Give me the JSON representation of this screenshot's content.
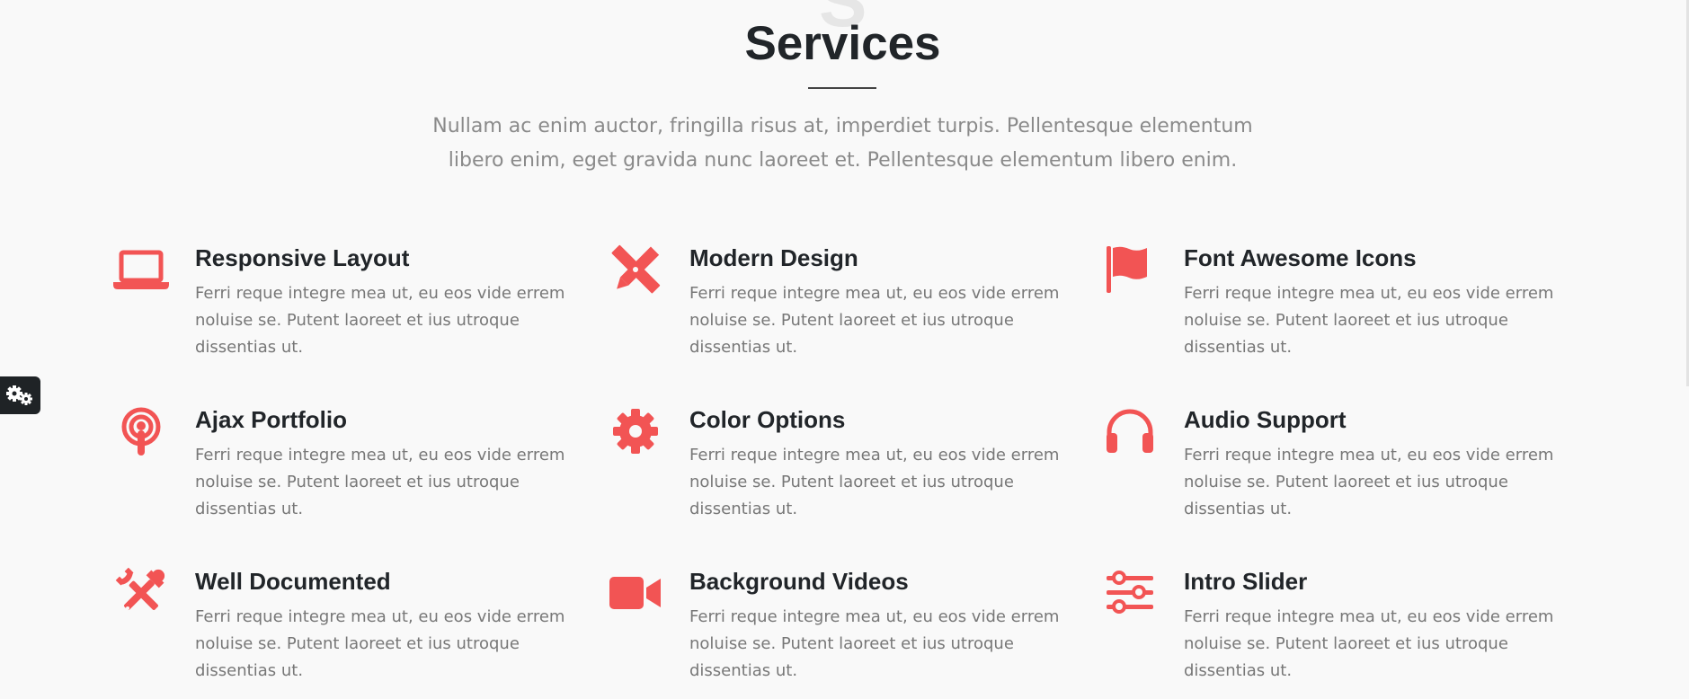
{
  "section": {
    "watermark": "S",
    "title": "Services",
    "lead": "Nullam ac enim auctor, fringilla risus at, imperdiet turpis. Pellentesque elementum libero enim, eget gravida nunc laoreet et. Pellentesque elementum libero enim."
  },
  "colors": {
    "accent": "#f25454",
    "heading": "#212529",
    "body_text": "#777777",
    "background": "#f9f9f9"
  },
  "features": [
    {
      "icon": "laptop-icon",
      "title": "Responsive Layout",
      "text": "Ferri reque integre mea ut, eu eos vide errem noluise se. Putent laoreet et ius utroque dissentias ut."
    },
    {
      "icon": "pencil-ruler-icon",
      "title": "Modern Design",
      "text": "Ferri reque integre mea ut, eu eos vide errem noluise se. Putent laoreet et ius utroque dissentias ut."
    },
    {
      "icon": "flag-icon",
      "title": "Font Awesome Icons",
      "text": "Ferri reque integre mea ut, eu eos vide errem noluise se. Putent laoreet et ius utroque dissentias ut."
    },
    {
      "icon": "podcast-icon",
      "title": "Ajax Portfolio",
      "text": "Ferri reque integre mea ut, eu eos vide errem noluise se. Putent laoreet et ius utroque dissentias ut."
    },
    {
      "icon": "gear-icon",
      "title": "Color Options",
      "text": "Ferri reque integre mea ut, eu eos vide errem noluise se. Putent laoreet et ius utroque dissentias ut."
    },
    {
      "icon": "headphones-icon",
      "title": "Audio Support",
      "text": "Ferri reque integre mea ut, eu eos vide errem noluise se. Putent laoreet et ius utroque dissentias ut."
    },
    {
      "icon": "tools-icon",
      "title": "Well Documented",
      "text": "Ferri reque integre mea ut, eu eos vide errem noluise se. Putent laoreet et ius utroque dissentias ut."
    },
    {
      "icon": "video-camera-icon",
      "title": "Background Videos",
      "text": "Ferri reque integre mea ut, eu eos vide errem noluise se. Putent laoreet et ius utroque dissentias ut."
    },
    {
      "icon": "sliders-icon",
      "title": "Intro Slider",
      "text": "Ferri reque integre mea ut, eu eos vide errem noluise se. Putent laoreet et ius utroque dissentias ut."
    }
  ],
  "settings_tab": {
    "icon": "gears-icon"
  }
}
